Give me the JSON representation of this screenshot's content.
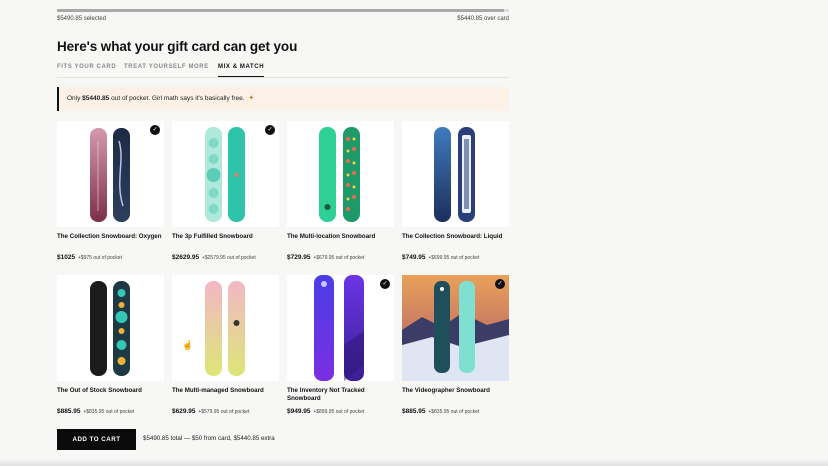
{
  "progress": {
    "fraction": 0.99
  },
  "selection": {
    "left": "$5490.85 selected",
    "right": "$5440.85 over card"
  },
  "title": "Here's what your gift card can get you",
  "tabs": [
    {
      "label": "FITS YOUR CARD",
      "active": false
    },
    {
      "label": "TREAT YOURSELF MORE",
      "active": false
    },
    {
      "label": "MIX & MATCH",
      "active": true
    }
  ],
  "banner": {
    "prefix": "Only ",
    "amount": "$5440.85",
    "suffix": " out of pocket. Girl math says it's basically free.",
    "icon": "party-icon"
  },
  "products": [
    {
      "name": "The Collection Snowboard: Oxygen",
      "price": "$1025",
      "oop": "+$975 out of pocket",
      "checked": true
    },
    {
      "name": "The 3p Fulfilled Snowboard",
      "price": "$2629.95",
      "oop": "+$2579.95 out of pocket",
      "checked": true
    },
    {
      "name": "The Multi-location Snowboard",
      "price": "$729.95",
      "oop": "+$679.95 out of pocket",
      "checked": false
    },
    {
      "name": "The Collection Snowboard: Liquid",
      "price": "$749.95",
      "oop": "+$699.95 out of pocket",
      "checked": false
    },
    {
      "name": "The Out of Stock Snowboard",
      "price": "$885.95",
      "oop": "+$835.95 out of pocket",
      "checked": false
    },
    {
      "name": "The Multi-managed Snowboard",
      "price": "$629.95",
      "oop": "+$579.95 out of pocket",
      "checked": false
    },
    {
      "name": "The Inventory Not Tracked Snowboard",
      "price": "$949.95",
      "oop": "+$899.95 out of pocket",
      "checked": true
    },
    {
      "name": "The Videographer Snowboard",
      "price": "$885.95",
      "oop": "+$835.95 out of pocket",
      "checked": true
    }
  ],
  "cart": {
    "button": "ADD TO CART",
    "summary": "$5490.85 total — $50 from card, $5440.85 extra"
  },
  "colors": {
    "accent": "#111111",
    "banner_bg": "#fbf1e6"
  },
  "icons": {
    "check": "checkmark-icon",
    "cursor": "hand-pointer-icon"
  }
}
